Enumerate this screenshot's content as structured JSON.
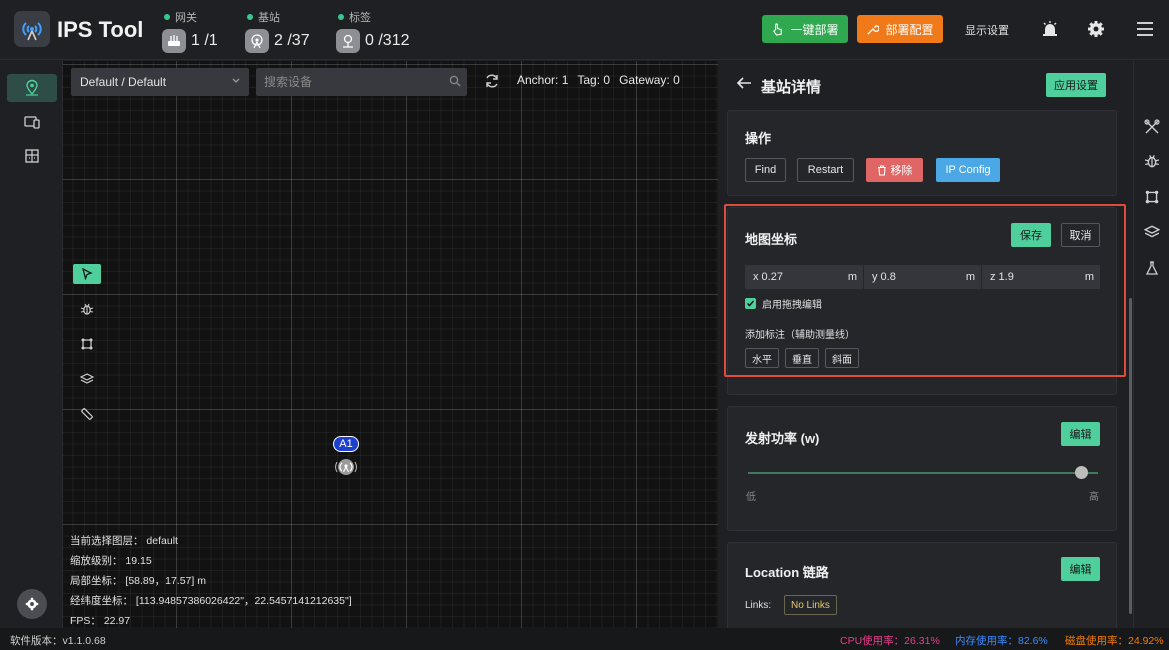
{
  "app": {
    "title": "IPS Tool"
  },
  "stats": [
    {
      "label": "网关",
      "value": "1 /1",
      "icon": "gateway-icon"
    },
    {
      "label": "基站",
      "value": "2 /37",
      "icon": "anchor-icon"
    },
    {
      "label": "标签",
      "value": "0 /312",
      "icon": "tag-icon"
    }
  ],
  "toolbar": {
    "deploy_label": "一键部署",
    "config_label": "部署配置",
    "display_label": "显示设置"
  },
  "map": {
    "floor_select": "Default / Default",
    "search_placeholder": "搜索设备",
    "counts": {
      "anchor": "Anchor: 1",
      "tag": "Tag: 0",
      "gateway": "Gateway: 0"
    },
    "anchor_label": "A1",
    "info": {
      "layer": "当前选择图层： default",
      "zoom": "缩放级别： 19.15",
      "local": "局部坐标： [58.89，17.57] m",
      "lonlat": "经纬度坐标： [113.94857386026422\"，22.5457141212635\"]",
      "fps": "FPS： 22.97"
    }
  },
  "panel": {
    "title": "基站详情",
    "apply_label": "应用设置",
    "ops": {
      "title": "操作",
      "find": "Find",
      "restart": "Restart",
      "remove": "移除",
      "ipconfig": "IP Config"
    },
    "coords": {
      "title": "地图坐标",
      "save": "保存",
      "cancel": "取消",
      "x": "x 0.27",
      "y": "y 0.8",
      "z": "z 1.9",
      "unit": "m",
      "drag_label": "启用拖拽编辑",
      "add_mark_label": "添加标注（辅助测量线）",
      "mark_h": "水平",
      "mark_v": "垂直",
      "mark_s": "斜面"
    },
    "power": {
      "title": "发射功率 (w)",
      "edit": "编辑",
      "low": "低",
      "high": "高",
      "level": 0.95
    },
    "location": {
      "title": "Location 链路",
      "edit": "编辑",
      "links_label": "Links:",
      "links_value": "No Links"
    }
  },
  "status": {
    "version": "软件版本：v1.1.0.68",
    "cpu": "CPU使用率：26.31%",
    "mem": "内存使用率：82.6%",
    "disk": "磁盘使用率：24.92%",
    "cpu_color": "#e83e8c",
    "mem_color": "#3d8bfd",
    "disk_color": "#f57c00"
  },
  "colors": {
    "accent": "#4ecf9c",
    "deploy": "#2fa84f",
    "config": "#f07a1a",
    "highlight": "#e04b3c"
  }
}
